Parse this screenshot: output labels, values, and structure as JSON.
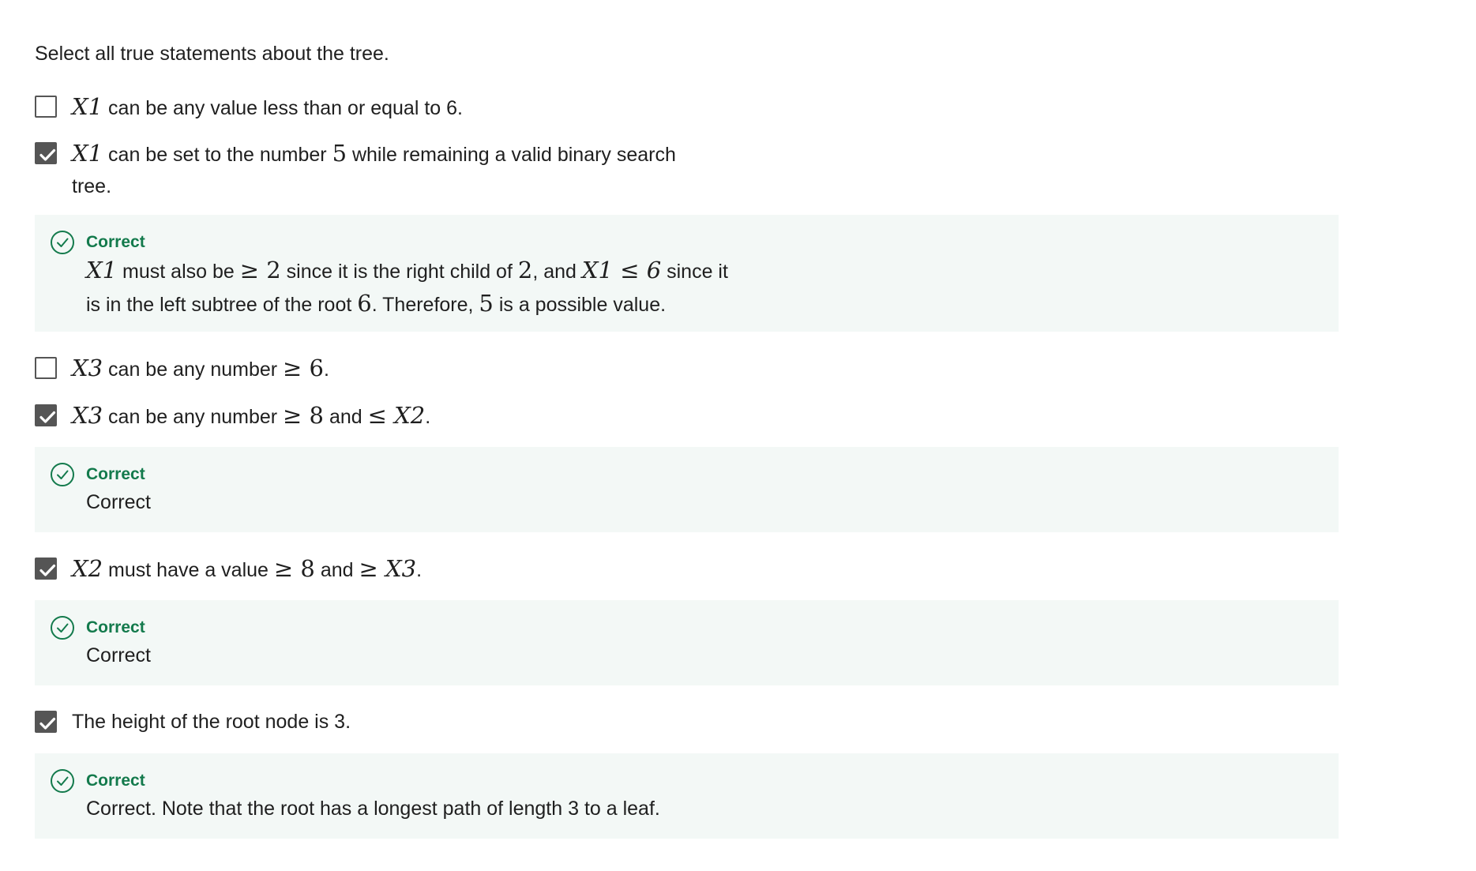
{
  "question": {
    "prompt": "Select all true statements about the tree."
  },
  "options": [
    {
      "checked": false,
      "var": "X1",
      "text": " can be any value less than or equal to 6."
    },
    {
      "checked": true,
      "var": "X1",
      "pre": " can be set to the number ",
      "num": "5",
      "post": " while remaining a valid binary search tree."
    },
    {
      "checked": false,
      "var": "X3",
      "pre": " can be any number ",
      "num": "≥ 6",
      "post": "."
    },
    {
      "checked": true,
      "var": "X3",
      "pre": " can be any number ",
      "num": "≥ 8",
      "mid": " and ",
      "num2": "≤ X2",
      "post": "."
    },
    {
      "checked": true,
      "var": "X2",
      "pre": " must have a value ",
      "num": "≥ 8",
      "mid": " and ",
      "num2": "≥ X3",
      "post": "."
    },
    {
      "checked": true,
      "text": "The height of the root node is 3."
    }
  ],
  "feedback": [
    {
      "label": "Correct",
      "m1": "X1",
      "t1": " must also be ",
      "m2": "≥ 2",
      "t2": " since it is the right child of ",
      "m3": "2",
      "t3": ", and ",
      "m4": "X1 ≤ 6",
      "t4": " since it is in the left subtree of the root ",
      "m5": "6",
      "t5": ". Therefore, ",
      "m6": "5",
      "t6": " is a possible value."
    },
    {
      "label": "Correct",
      "text": "Correct"
    },
    {
      "label": "Correct",
      "text": "Correct"
    },
    {
      "label": "Correct",
      "text": "Correct. Note that the root has a longest path of length 3 to a leaf."
    }
  ],
  "colors": {
    "correct_green": "#137a4c",
    "feedback_bg": "#f3f8f6",
    "checkbox_gray": "#555555"
  }
}
